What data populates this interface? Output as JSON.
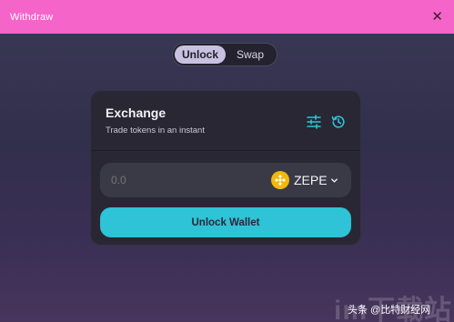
{
  "window": {
    "title": "Withdraw",
    "close_glyph": "✕"
  },
  "toggle": {
    "options": [
      "Unlock",
      "Swap"
    ],
    "selected": "Unlock"
  },
  "card": {
    "title": "Exchange",
    "subtitle": "Trade tokens in an instant",
    "icons": [
      "settings-sliders-icon",
      "history-icon"
    ]
  },
  "input": {
    "amount_placeholder": "0.0",
    "token_symbol": "ZEPE",
    "token_icon": "zepe-token-icon"
  },
  "button": {
    "label": "Unlock Wallet"
  },
  "watermark": {
    "big": "im下载站",
    "small": "头条 @比特财经网"
  },
  "colors": {
    "titlebar": "#f564c9",
    "accent_button": "#2ec3d6",
    "card_bg": "#282733",
    "token_logo": "#f0b90b"
  }
}
